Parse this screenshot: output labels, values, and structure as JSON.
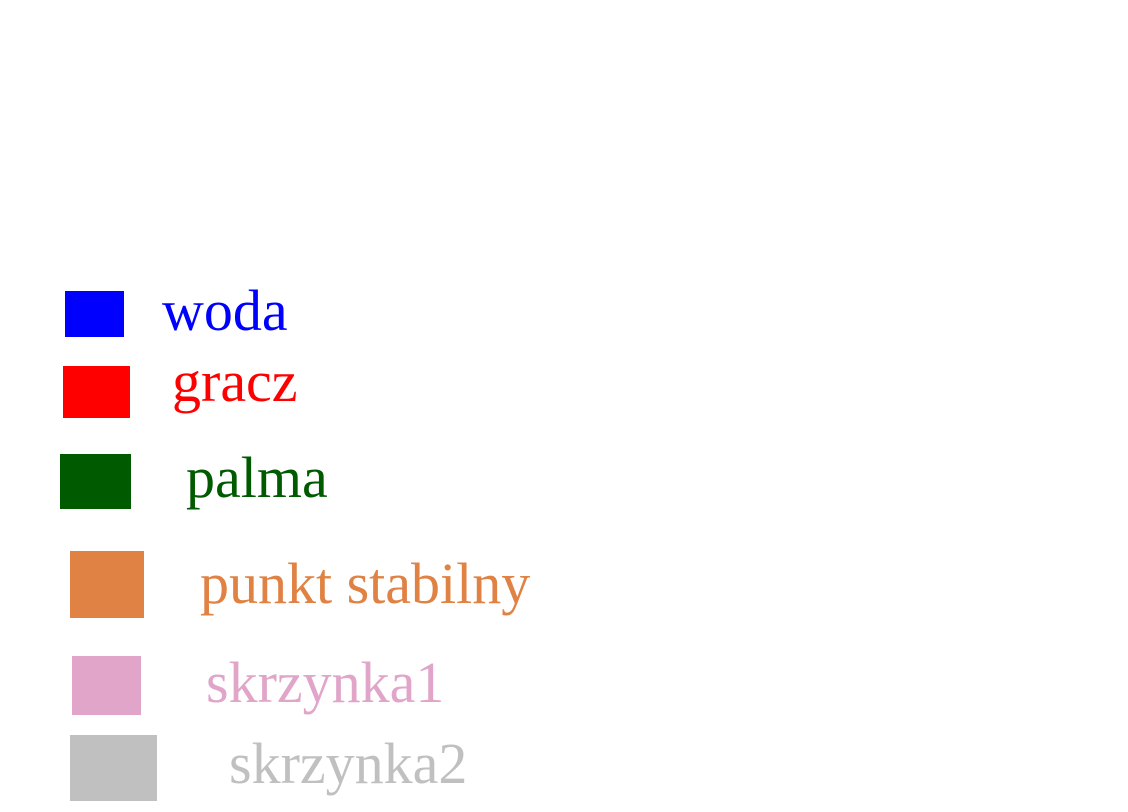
{
  "legend": {
    "items": [
      {
        "label": "woda",
        "color": "#0000ff",
        "text_color": "#0000ff"
      },
      {
        "label": "gracz",
        "color": "#ff0000",
        "text_color": "#ff0000"
      },
      {
        "label": "palma",
        "color": "#005a00",
        "text_color": "#005a00"
      },
      {
        "label": "punkt stabilny",
        "color": "#df8243",
        "text_color": "#df8243"
      },
      {
        "label": "skrzynka1",
        "color": "#e0a5c8",
        "text_color": "#e0a5c8"
      },
      {
        "label": "skrzynka2",
        "color": "#c0c0c0",
        "text_color": "#c0c0c0"
      }
    ]
  }
}
